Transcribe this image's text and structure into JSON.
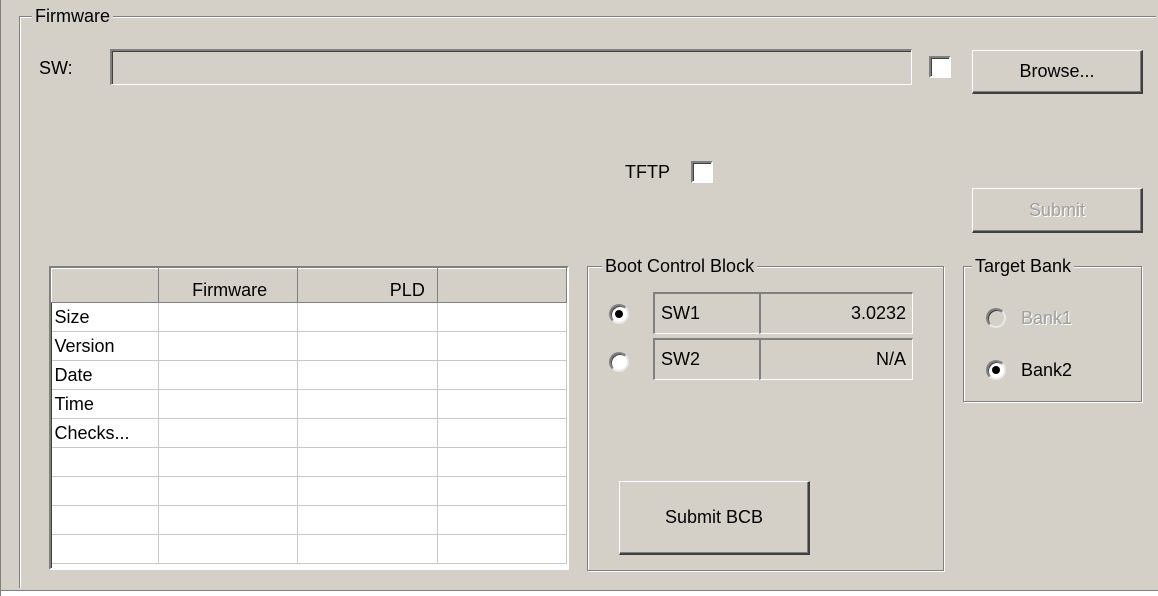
{
  "firmware_group": {
    "legend": "Firmware",
    "sw_label": "SW:",
    "sw_path": "",
    "browse_label": "Browse...",
    "tftp_label": "TFTP",
    "submit_label": "Submit"
  },
  "info_table": {
    "columns": [
      "",
      "Firmware",
      "PLD",
      ""
    ],
    "rows": [
      {
        "label": "Size",
        "firmware": "",
        "pld": "",
        "extra": ""
      },
      {
        "label": "Version",
        "firmware": "",
        "pld": "",
        "extra": ""
      },
      {
        "label": "Date",
        "firmware": "",
        "pld": "",
        "extra": ""
      },
      {
        "label": "Time",
        "firmware": "",
        "pld": "",
        "extra": ""
      },
      {
        "label": "Checks...",
        "firmware": "",
        "pld": "",
        "extra": ""
      },
      {
        "label": "",
        "firmware": "",
        "pld": "",
        "extra": ""
      },
      {
        "label": "",
        "firmware": "",
        "pld": "",
        "extra": ""
      },
      {
        "label": "",
        "firmware": "",
        "pld": "",
        "extra": ""
      },
      {
        "label": "",
        "firmware": "",
        "pld": "",
        "extra": ""
      }
    ]
  },
  "boot_control_block": {
    "legend": "Boot Control Block",
    "entries": [
      {
        "name": "SW1",
        "value": "3.0232",
        "selected": true
      },
      {
        "name": "SW2",
        "value": "N/A",
        "selected": false
      }
    ],
    "submit_label": "Submit BCB"
  },
  "target_bank": {
    "legend": "Target Bank",
    "options": [
      {
        "label": "Bank1",
        "selected": false,
        "enabled": false
      },
      {
        "label": "Bank2",
        "selected": true,
        "enabled": true
      }
    ]
  }
}
